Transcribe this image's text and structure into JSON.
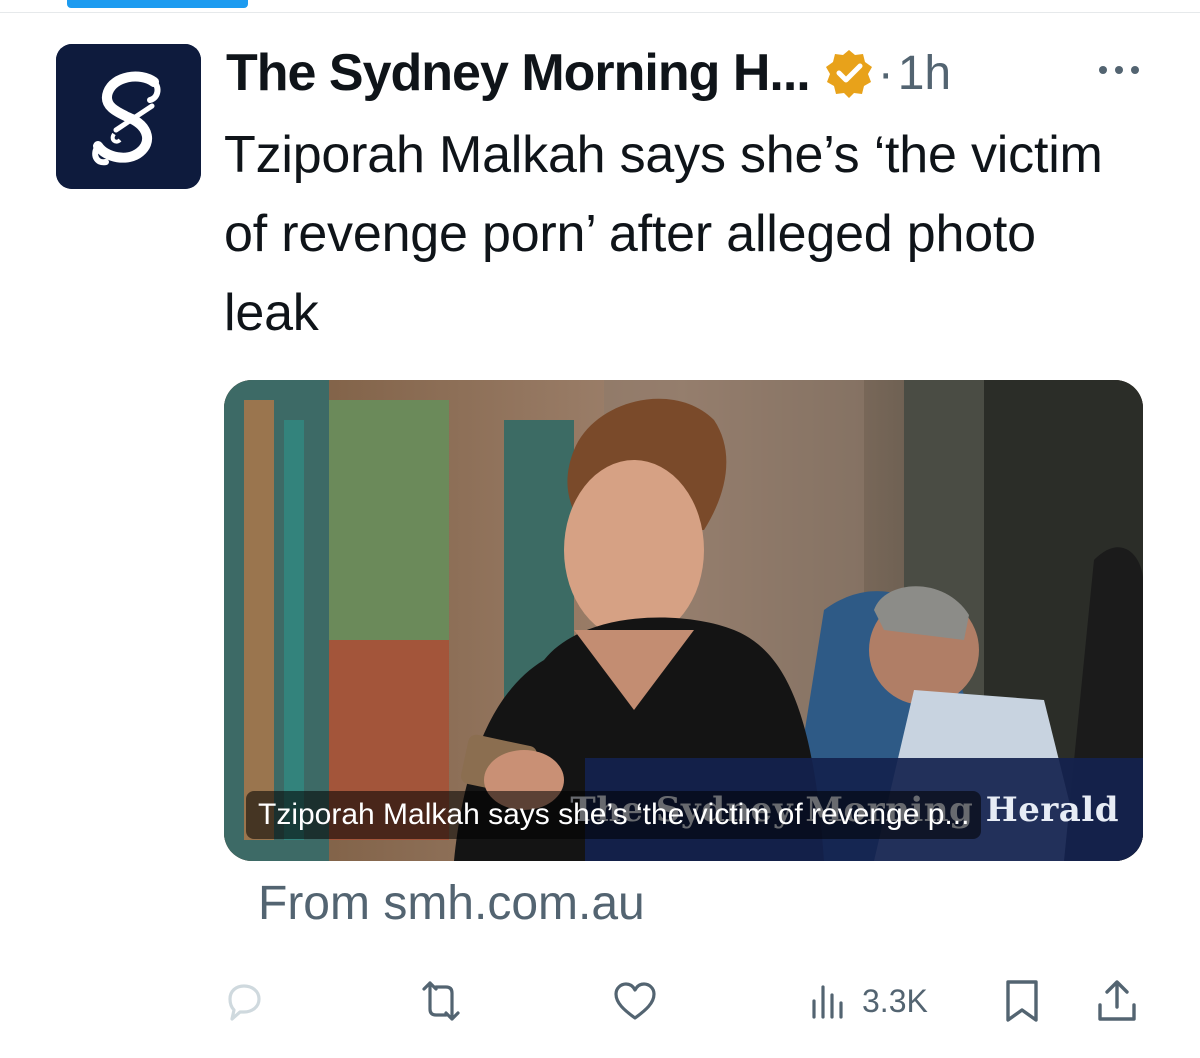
{
  "post": {
    "author_name": "The Sydney Morning H...",
    "separator": "·",
    "timestamp": "1h",
    "text": "Tziporah Malkah says she’s ‘the victim of revenge porn’ after alleged photo leak"
  },
  "card": {
    "watermark": "The Sydney Morning Herald",
    "caption": "Tziporah Malkah says she’s ‘the victim of revenge p...",
    "source": "From smh.com.au"
  },
  "actions": {
    "views_count": "3.3K"
  },
  "colors": {
    "accent": "#1d9bf0",
    "verified_gold": "#e8a21a",
    "muted_text": "#536471",
    "avatar_bg": "#0e1b3d"
  },
  "icons": [
    "smh-logo",
    "verified-badge-icon",
    "more-icon",
    "reply-icon",
    "repost-icon",
    "like-icon",
    "views-icon",
    "bookmark-icon",
    "share-icon"
  ]
}
